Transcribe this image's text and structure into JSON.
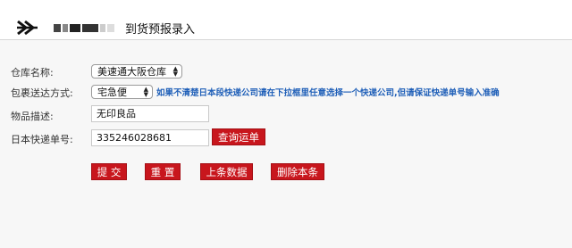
{
  "header": {
    "title": "到货预报录入"
  },
  "form": {
    "warehouse": {
      "label": "仓库名称:",
      "selected": "美速通大阪仓库"
    },
    "delivery": {
      "label": "包裹送达方式:",
      "selected": "宅急便",
      "hint": "如果不清楚日本段快递公司请在下拉框里任意选择一个快递公司,但请保证快递单号输入准确"
    },
    "description": {
      "label": "物品描述:",
      "value": "无印良品"
    },
    "tracking": {
      "label": "日本快递单号:",
      "value": "335246028681",
      "query_button": "查询运单"
    }
  },
  "actions": {
    "submit": "提 交",
    "reset": "重 置",
    "previous": "上条数据",
    "delete": "删除本条"
  },
  "colors": {
    "button_red": "#c8161d",
    "hint_blue": "#1f5fb8"
  }
}
